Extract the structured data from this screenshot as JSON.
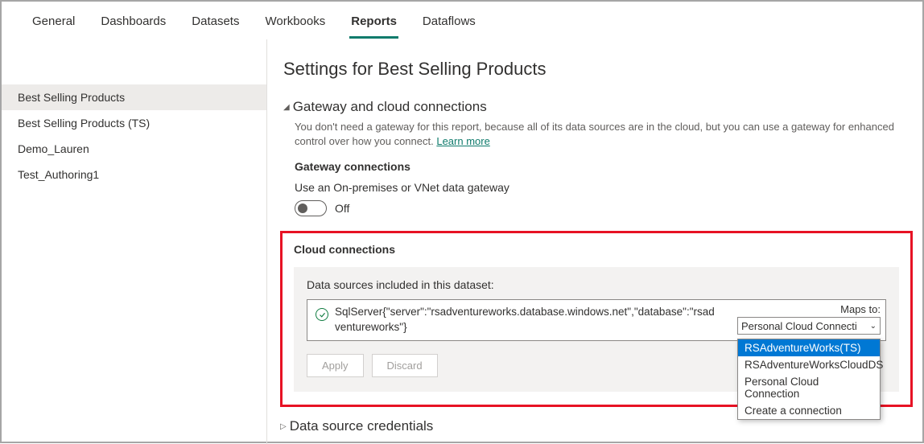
{
  "tabs": {
    "items": [
      "General",
      "Dashboards",
      "Datasets",
      "Workbooks",
      "Reports",
      "Dataflows"
    ],
    "active_index": 4
  },
  "sidebar": {
    "items": [
      "Best Selling Products",
      "Best Selling Products (TS)",
      "Demo_Lauren",
      "Test_Authoring1"
    ],
    "active_index": 0
  },
  "main": {
    "title": "Settings for Best Selling Products",
    "gateway_section": {
      "header": "Gateway and cloud connections",
      "description": "You don't need a gateway for this report, because all of its data sources are in the cloud, but you can use a gateway for enhanced control over how you connect.",
      "learn_more": "Learn more",
      "gateway_conn_title": "Gateway connections",
      "toggle_prompt": "Use an On-premises or VNet data gateway",
      "toggle_state": "Off"
    },
    "cloud_section": {
      "title": "Cloud connections",
      "panel_label": "Data sources included in this dataset:",
      "ds_text": "SqlServer{\"server\":\"rsadventureworks.database.windows.net\",\"database\":\"rsadventureworks\"}",
      "maps_label": "Maps to:",
      "maps_selected": "Personal Cloud Connecti",
      "dropdown_options": [
        "RSAdventureWorks(TS)",
        "RSAdventureWorksCloudDS",
        "Personal Cloud Connection",
        "Create a connection"
      ],
      "dropdown_selected_index": 0,
      "apply_label": "Apply",
      "discard_label": "Discard"
    },
    "credentials_header": "Data source credentials"
  }
}
